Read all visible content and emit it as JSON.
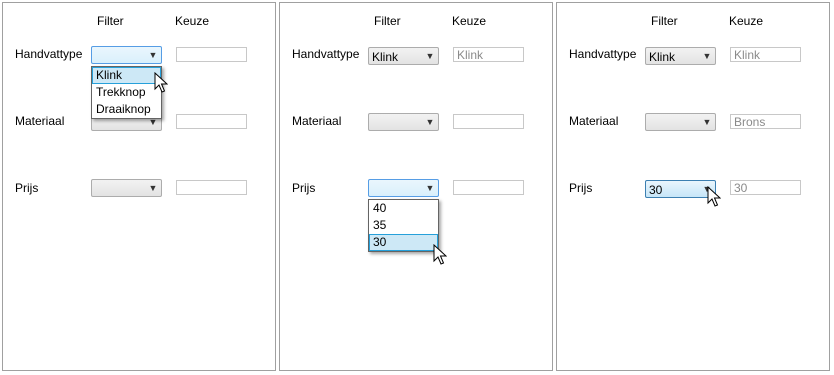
{
  "headers": {
    "filter": "Filter",
    "keuze": "Keuze"
  },
  "labels": {
    "handvattype": "Handvattype",
    "materiaal": "Materiaal",
    "prijs": "Prijs"
  },
  "panel1": {
    "handvattype_combo": "",
    "materiaal_combo": "",
    "prijs_combo": "",
    "handvattype_keuze": "",
    "materiaal_keuze": "",
    "prijs_keuze": "",
    "dropdown_options": [
      "Klink",
      "Trekknop",
      "Draaiknop"
    ],
    "highlighted_option": "Klink"
  },
  "panel2": {
    "handvattype_combo": "Klink",
    "materiaal_combo": "",
    "prijs_combo": "",
    "handvattype_keuze": "Klink",
    "materiaal_keuze": "",
    "prijs_keuze": "",
    "dropdown_options": [
      "40",
      "35",
      "30"
    ],
    "highlighted_option": "30"
  },
  "panel3": {
    "handvattype_combo": "Klink",
    "materiaal_combo": "",
    "prijs_combo": "30",
    "handvattype_keuze": "Klink",
    "materiaal_keuze": "Brons",
    "prijs_keuze": "30"
  },
  "icons": {
    "dropdown_arrow": "chevron-down-icon",
    "cursor": "mouse-pointer-icon"
  },
  "colors": {
    "highlight_bg": "#cde8f6",
    "highlight_border": "#26a0da",
    "disabled_text": "#8a8a8a"
  }
}
